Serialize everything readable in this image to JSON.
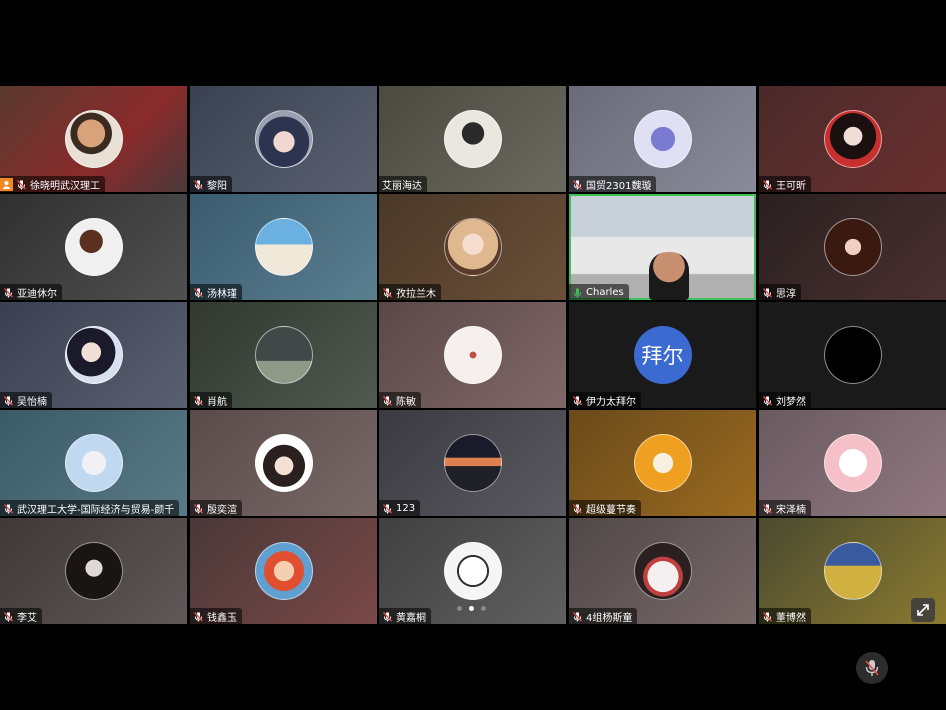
{
  "participants": [
    {
      "name": "徐晓明武汉理工",
      "bg": "linear-gradient(135deg,#5a3a30,#8a2a2a 60%,#4a3a3a)",
      "avatar_bg": "radial-gradient(circle at 45% 40%,#d9a37a 0 30%,#3a2a20 31% 45%,#e8e0d5 46%)",
      "host": true,
      "muted": true
    },
    {
      "name": "黎阳",
      "bg": "linear-gradient(135deg,#3a4252,#5a6070)",
      "avatar_bg": "radial-gradient(circle at 50% 55%,#f0d8d0 0 25%,#2c3450 26% 60%,#9aa0b0 61%)",
      "muted": true
    },
    {
      "name": "艾丽海达",
      "bg": "linear-gradient(135deg,#4a4a40,#6a6a60)",
      "avatar_bg": "radial-gradient(circle at 50% 40%,#2a2a2a 0 25%,#e8e8e0 26%)",
      "muted": false
    },
    {
      "name": "国贸2301魏璇",
      "bg": "linear-gradient(135deg,#6a6a78,#8a8a98)",
      "avatar_bg": "radial-gradient(circle at 50% 50%,#7a7ad0 0 30%,#e0e0f5 31%)",
      "muted": true
    },
    {
      "name": "王可昕",
      "bg": "linear-gradient(135deg,#4a2a2a,#6a3030)",
      "avatar_bg": "radial-gradient(circle at 50% 45%,#f2ddd5 0 22%,#1a1010 23% 55%,#c83030 56%)",
      "muted": true
    },
    {
      "name": "亚迪休尔",
      "bg": "linear-gradient(135deg,#303030,#505050)",
      "avatar_bg": "radial-gradient(circle at 45% 40%,#5a3020 0 25%,#f0f0f0 26%)",
      "muted": true
    },
    {
      "name": "汤林瑾",
      "bg": "linear-gradient(135deg,#3a5a70,#5a8090)",
      "avatar_bg": "linear-gradient(180deg,#6ab0e0 0 45%,#f0e8d8 46%)",
      "muted": true
    },
    {
      "name": "孜拉兰木",
      "bg": "linear-gradient(135deg,#4a3828,#6a5038)",
      "avatar_bg": "radial-gradient(circle at 50% 45%,#f5ddd0 0 25%,#e0b890 26% 60%,#5a3a2a 61%)",
      "muted": true
    },
    {
      "name": "Charles",
      "bg": "linear-gradient(180deg,#c8d0d8 0 40%,#e8e8e8 41% 75%,#b0b0b0 76%)",
      "avatar_bg": "",
      "video": true,
      "active": true,
      "muted": false
    },
    {
      "name": "思淳",
      "bg": "linear-gradient(135deg,#2a2020,#4a3030)",
      "avatar_bg": "radial-gradient(circle at 50% 50%,#f0d0c0 0 20%,#3a1a10 21%)",
      "muted": true
    },
    {
      "name": "吴怡楠",
      "bg": "linear-gradient(135deg,#3a4050,#5a6070)",
      "avatar_bg": "radial-gradient(circle at 45% 45%,#f0e0d5 0 22%,#1a1a2a 23% 55%,#d8e0f0 56%)",
      "muted": true
    },
    {
      "name": "肖航",
      "bg": "linear-gradient(135deg,#303830,#505a50)",
      "avatar_bg": "linear-gradient(180deg,#404848 0 60%,#909888 61%)",
      "muted": true
    },
    {
      "name": "陈敏",
      "bg": "linear-gradient(135deg,#5a4848,#806868)",
      "avatar_bg": "radial-gradient(circle at 50% 50%,#c05040 0 8%,#f5f0ee 9%)",
      "muted": true
    },
    {
      "name": "伊力太拜尔",
      "bg": "#1a1a1a",
      "avatar_text": "拜尔",
      "avatar_bg": "#3b6ad0",
      "muted": true
    },
    {
      "name": "刘梦然",
      "bg": "#1a1a1a",
      "avatar_bg": "#000",
      "muted": true
    },
    {
      "name": "武汉理工大学-国际经济与贸易-颜千",
      "bg": "linear-gradient(135deg,#3a5a68,#5a7a88)",
      "avatar_bg": "radial-gradient(circle at 50% 50%,#f0f0f5 0 30%,#c0d8f0 31%)",
      "muted": true
    },
    {
      "name": "殷奕渲",
      "bg": "linear-gradient(135deg,#5a4a4a,#786868)",
      "avatar_bg": "radial-gradient(circle at 50% 55%,#f5e0d5 0 22%,#2a2020 23% 50%,#fff 51%)",
      "muted": true
    },
    {
      "name": "123",
      "bg": "linear-gradient(135deg,#3a3a40,#5a5a60)",
      "avatar_bg": "linear-gradient(180deg,#1a1a2a 0 40%,#e08050 41% 55%,#202028 56%)",
      "muted": true
    },
    {
      "name": "超级蔓节奏",
      "bg": "linear-gradient(135deg,#6a4a1a,#9a6a20)",
      "avatar_bg": "radial-gradient(circle at 50% 50%,#f5f0e0 0 25%,#f0a020 26%)",
      "muted": true
    },
    {
      "name": "宋泽楠",
      "bg": "linear-gradient(135deg,#6a5a60,#907880)",
      "avatar_bg": "radial-gradient(circle at 50% 50%,#fff 0 35%,#f5c0c8 36%)",
      "muted": true
    },
    {
      "name": "李艾",
      "bg": "linear-gradient(135deg,#403838,#605858)",
      "avatar_bg": "radial-gradient(circle at 50% 45%,#e0d8d8 0 20%,#1a1515 21%)",
      "muted": true
    },
    {
      "name": "钱鑫玉",
      "bg": "linear-gradient(135deg,#4a3838,#7a4848)",
      "avatar_bg": "radial-gradient(circle at 50% 50%,#f5d0b0 0 25%,#e05030 26% 50%,#60a0d0 51%)",
      "muted": true
    },
    {
      "name": "黄嘉桐",
      "bg": "linear-gradient(135deg,#404040,#606060)",
      "avatar_bg": "radial-gradient(circle at 50% 50%,#fff 0 35%,#303030 36% 40%,#f5f5f5 41%)",
      "muted": true
    },
    {
      "name": "4组杨斯童",
      "bg": "linear-gradient(135deg,#504848,#786868)",
      "avatar_bg": "radial-gradient(circle at 50% 60%,#f5f0f0 0 35%,#c04040 36% 45%,#2a2020 46%)",
      "muted": true
    },
    {
      "name": "董博然",
      "bg": "linear-gradient(135deg,#4a4a30,#8a7a30)",
      "avatar_bg": "linear-gradient(180deg,#3a5aa0 0 40%,#d0b040 41%)",
      "muted": true
    }
  ],
  "pagination": {
    "count": 3,
    "current": 1
  },
  "colors": {
    "active_border": "#3fbf5a",
    "host_badge": "#f08a24",
    "muted_icon": "#e05050",
    "mic_on": "#3fbf5a"
  }
}
